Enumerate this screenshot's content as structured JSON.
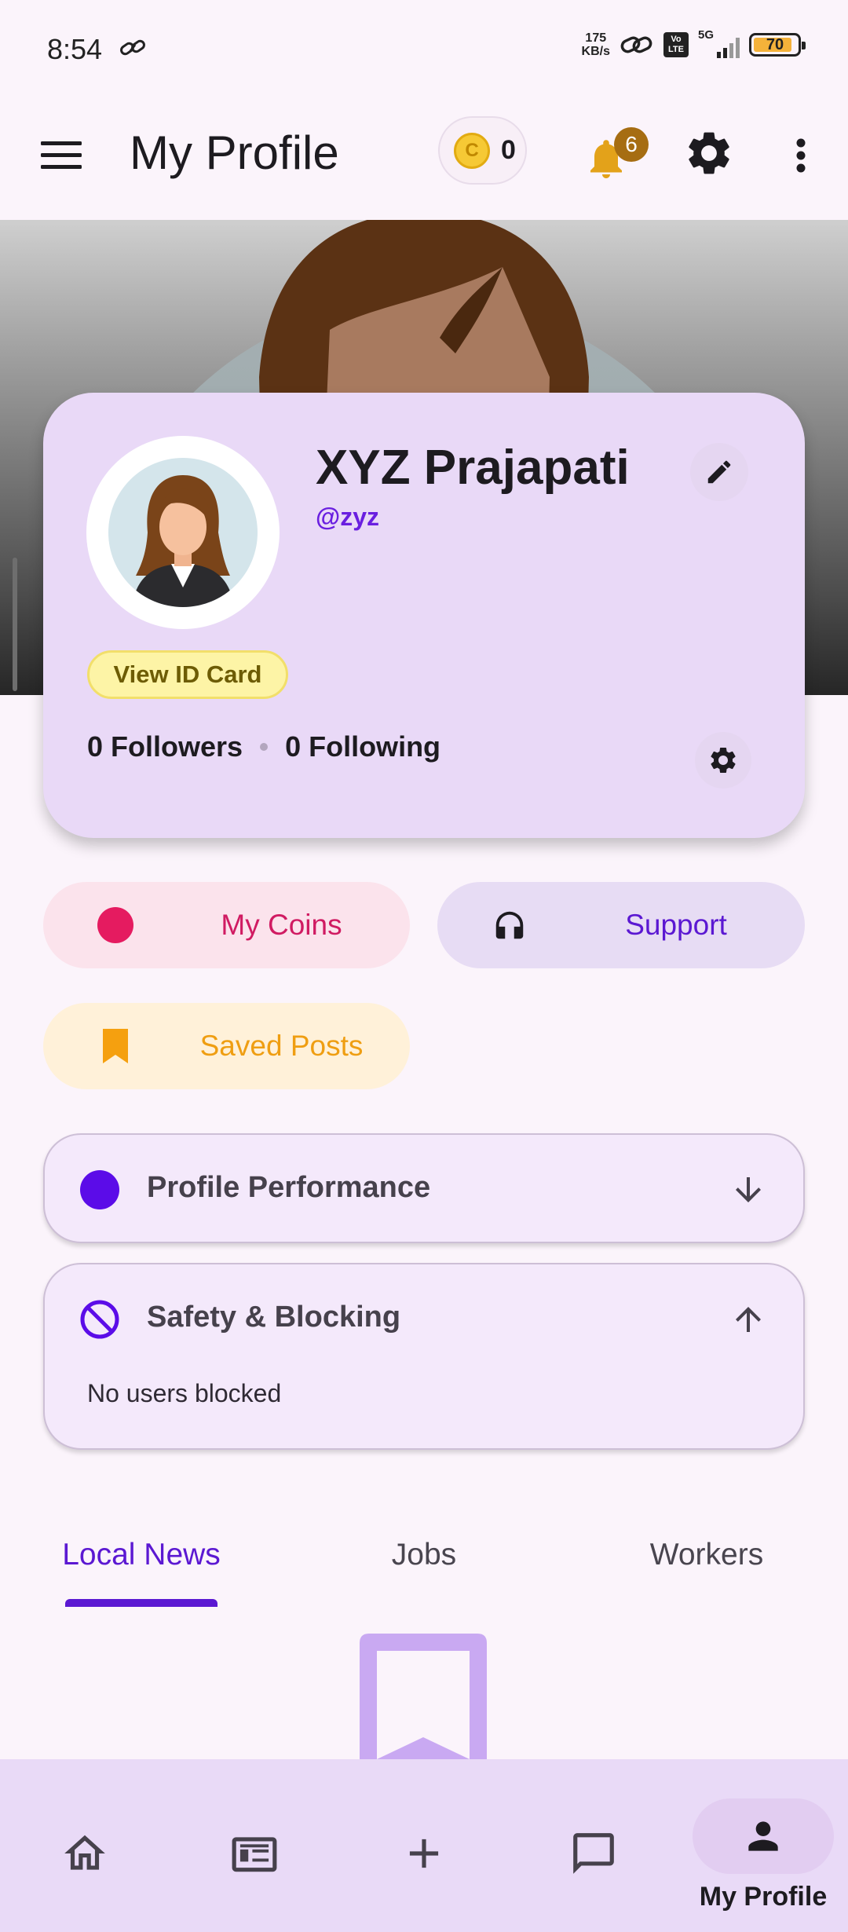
{
  "status_bar": {
    "time": "8:54",
    "speed_value": "175",
    "speed_unit": "KB/s",
    "volte": "Vo LTE",
    "network": "5G",
    "battery": "70"
  },
  "appbar": {
    "title": "My Profile",
    "coin_count": "0",
    "coin_symbol": "C",
    "notification_count": "6"
  },
  "profile": {
    "name": "XYZ Prajapati",
    "handle": "@zyz",
    "id_card_label": "View ID Card",
    "followers": "0 Followers",
    "following": "0 Following"
  },
  "actions": {
    "coins_label": "My Coins",
    "support_label": "Support",
    "saved_label": "Saved Posts"
  },
  "sections": {
    "performance_title": "Profile Performance",
    "safety_title": "Safety & Blocking",
    "safety_body": "No users blocked"
  },
  "tabs": {
    "items": [
      "Local News",
      "Jobs",
      "Workers"
    ],
    "active": "Local News"
  },
  "bottom_nav": {
    "active_label": "My Profile",
    "items": [
      "home-icon",
      "news-icon",
      "add-icon",
      "chat-icon",
      "person-icon"
    ]
  },
  "colors": {
    "accent": "#5b18d2",
    "card_bg": "#e9d9f7",
    "coins_text": "#d01b62",
    "saved_text": "#ef9e12",
    "badge": "#a66d12"
  }
}
